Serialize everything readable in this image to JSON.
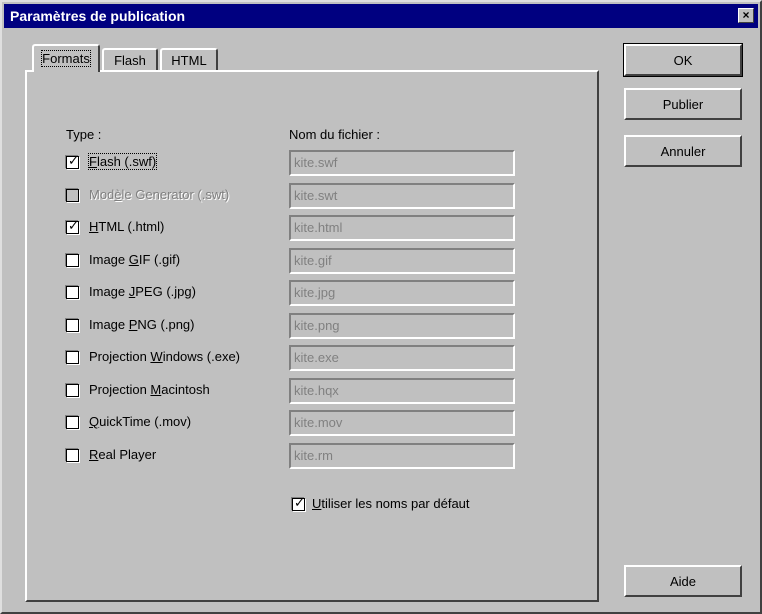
{
  "window": {
    "title": "Paramètres de publication",
    "close_glyph": "×"
  },
  "tabs": [
    {
      "label": "Formats"
    },
    {
      "label": "Flash"
    },
    {
      "label": "HTML"
    }
  ],
  "formats": {
    "type_header": "Type :",
    "filename_header": "Nom du fichier :",
    "options": [
      {
        "pre": "",
        "key": "F",
        "post": "lash (.swf)",
        "checked": true,
        "disabled": false,
        "filename": "kite.swf"
      },
      {
        "pre": "Mod",
        "key": "è",
        "post": "le Generator (.swt)",
        "checked": false,
        "disabled": true,
        "filename": "kite.swt"
      },
      {
        "pre": "",
        "key": "H",
        "post": "TML (.html)",
        "checked": true,
        "disabled": false,
        "filename": "kite.html"
      },
      {
        "pre": "Image ",
        "key": "G",
        "post": "IF (.gif)",
        "checked": false,
        "disabled": false,
        "filename": "kite.gif"
      },
      {
        "pre": "Image ",
        "key": "J",
        "post": "PEG (.jpg)",
        "checked": false,
        "disabled": false,
        "filename": "kite.jpg"
      },
      {
        "pre": "Image ",
        "key": "P",
        "post": "NG (.png)",
        "checked": false,
        "disabled": false,
        "filename": "kite.png"
      },
      {
        "pre": "Projection ",
        "key": "W",
        "post": "indows (.exe)",
        "checked": false,
        "disabled": false,
        "filename": "kite.exe"
      },
      {
        "pre": "Projection ",
        "key": "M",
        "post": "acintosh",
        "checked": false,
        "disabled": false,
        "filename": "kite.hqx"
      },
      {
        "pre": "",
        "key": "Q",
        "post": "uickTime (.mov)",
        "checked": false,
        "disabled": false,
        "filename": "kite.mov"
      },
      {
        "pre": "",
        "key": "R",
        "post": "eal Player",
        "checked": false,
        "disabled": false,
        "filename": "kite.rm"
      }
    ],
    "default_names": {
      "key": "U",
      "post": "tiliser les noms par défaut",
      "checked": true
    }
  },
  "buttons": {
    "ok": "OK",
    "publish": "Publier",
    "cancel": "Annuler",
    "help": "Aide"
  },
  "check_glyph": "✓"
}
